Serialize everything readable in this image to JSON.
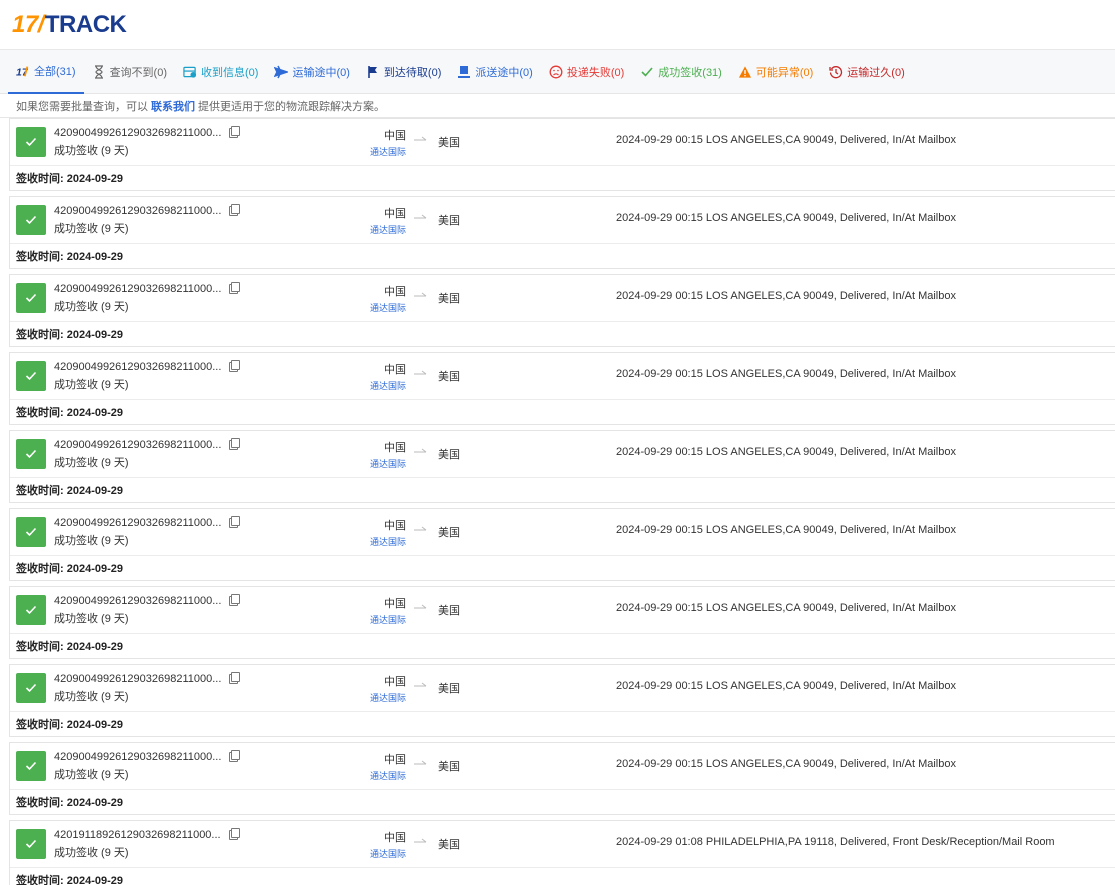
{
  "logo": {
    "num": "17",
    "word": "TRACK"
  },
  "tabs": [
    {
      "icon": "17track-icon",
      "label": "全部(31)",
      "color": "#2e6bd6",
      "active": true
    },
    {
      "icon": "hourglass-icon",
      "label": "查询不到(0)",
      "color": "#666666"
    },
    {
      "icon": "inbox-icon",
      "label": "收到信息(0)",
      "color": "#19a0c8"
    },
    {
      "icon": "airplane-icon",
      "label": "运输途中(0)",
      "color": "#2e6bd6"
    },
    {
      "icon": "flag-icon",
      "label": "到达待取(0)",
      "color": "#1a3c8f"
    },
    {
      "icon": "courier-icon",
      "label": "派送途中(0)",
      "color": "#2e6bd6"
    },
    {
      "icon": "sad-face-icon",
      "label": "投递失败(0)",
      "color": "#e53935"
    },
    {
      "icon": "check-icon",
      "label": "成功签收(31)",
      "color": "#4caf50"
    },
    {
      "icon": "warning-icon",
      "label": "可能异常(0)",
      "color": "#f57c00"
    },
    {
      "icon": "history-clock-icon",
      "label": "运输过久(0)",
      "color": "#c62828"
    }
  ],
  "notice": {
    "before": "如果您需要批量查询，可以",
    "link": "联系我们",
    "after": "提供更适用于您的物流跟踪解决方案。"
  },
  "colors": {
    "success": "#4caf50",
    "accent": "#2e6bd6"
  },
  "shipments": [
    {
      "tracking": "42090049926129032698211000...",
      "status": "成功签收 (9 天)",
      "origin": "中国",
      "carrier": "通达国际",
      "dest": "美国",
      "event": "2024-09-29 00:15  LOS ANGELES,CA 90049, Delivered, In/At Mailbox",
      "signed": "签收时间:  2024-09-29"
    },
    {
      "tracking": "42090049926129032698211000...",
      "status": "成功签收 (9 天)",
      "origin": "中国",
      "carrier": "通达国际",
      "dest": "美国",
      "event": "2024-09-29 00:15  LOS ANGELES,CA 90049, Delivered, In/At Mailbox",
      "signed": "签收时间:  2024-09-29"
    },
    {
      "tracking": "42090049926129032698211000...",
      "status": "成功签收 (9 天)",
      "origin": "中国",
      "carrier": "通达国际",
      "dest": "美国",
      "event": "2024-09-29 00:15  LOS ANGELES,CA 90049, Delivered, In/At Mailbox",
      "signed": "签收时间:  2024-09-29"
    },
    {
      "tracking": "42090049926129032698211000...",
      "status": "成功签收 (9 天)",
      "origin": "中国",
      "carrier": "通达国际",
      "dest": "美国",
      "event": "2024-09-29 00:15  LOS ANGELES,CA 90049, Delivered, In/At Mailbox",
      "signed": "签收时间:  2024-09-29"
    },
    {
      "tracking": "42090049926129032698211000...",
      "status": "成功签收 (9 天)",
      "origin": "中国",
      "carrier": "通达国际",
      "dest": "美国",
      "event": "2024-09-29 00:15  LOS ANGELES,CA 90049, Delivered, In/At Mailbox",
      "signed": "签收时间:  2024-09-29"
    },
    {
      "tracking": "42090049926129032698211000...",
      "status": "成功签收 (9 天)",
      "origin": "中国",
      "carrier": "通达国际",
      "dest": "美国",
      "event": "2024-09-29 00:15  LOS ANGELES,CA 90049, Delivered, In/At Mailbox",
      "signed": "签收时间:  2024-09-29"
    },
    {
      "tracking": "42090049926129032698211000...",
      "status": "成功签收 (9 天)",
      "origin": "中国",
      "carrier": "通达国际",
      "dest": "美国",
      "event": "2024-09-29 00:15  LOS ANGELES,CA 90049, Delivered, In/At Mailbox",
      "signed": "签收时间:  2024-09-29"
    },
    {
      "tracking": "42090049926129032698211000...",
      "status": "成功签收 (9 天)",
      "origin": "中国",
      "carrier": "通达国际",
      "dest": "美国",
      "event": "2024-09-29 00:15  LOS ANGELES,CA 90049, Delivered, In/At Mailbox",
      "signed": "签收时间:  2024-09-29"
    },
    {
      "tracking": "42090049926129032698211000...",
      "status": "成功签收 (9 天)",
      "origin": "中国",
      "carrier": "通达国际",
      "dest": "美国",
      "event": "2024-09-29 00:15  LOS ANGELES,CA 90049, Delivered, In/At Mailbox",
      "signed": "签收时间:  2024-09-29"
    },
    {
      "tracking": "42019118926129032698211000...",
      "status": "成功签收 (9 天)",
      "origin": "中国",
      "carrier": "通达国际",
      "dest": "美国",
      "event": "2024-09-29 01:08  PHILADELPHIA,PA 19118, Delivered, Front Desk/Reception/Mail Room",
      "signed": "签收时间:  2024-09-29"
    }
  ]
}
